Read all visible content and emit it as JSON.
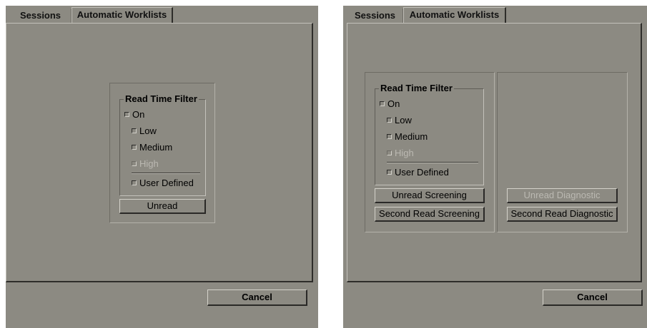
{
  "left_dialog": {
    "tabs": [
      "Sessions",
      "Automatic Worklists"
    ],
    "filter": {
      "legend": "Read Time Filter",
      "on": "On",
      "low": "Low",
      "medium": "Medium",
      "high": "High",
      "user_defined": "User Defined"
    },
    "unread_button": "Unread",
    "cancel_button": "Cancel"
  },
  "right_dialog": {
    "tabs": [
      "Sessions",
      "Automatic Worklists"
    ],
    "filter": {
      "legend": "Read Time Filter",
      "on": "On",
      "low": "Low",
      "medium": "Medium",
      "high": "High",
      "user_defined": "User Defined"
    },
    "unread_screening_button": "Unread Screening",
    "second_read_screening_button": "Second Read Screening",
    "unread_diagnostic_button": "Unread Diagnostic",
    "second_read_diagnostic_button": "Second Read Diagnostic",
    "cancel_button": "Cancel"
  }
}
